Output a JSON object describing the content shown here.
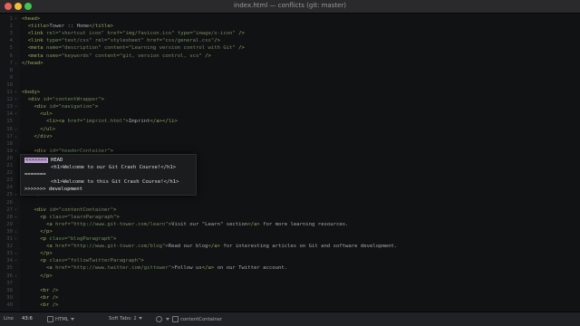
{
  "window": {
    "title": "index.html — conflicts (git: master)"
  },
  "colors": {
    "background": "#111214",
    "tag": "#9ea65c",
    "attr": "#6f8f4e",
    "string": "#6e8a57",
    "text": "#a8a8a2",
    "marker_highlight": "#bfa3d8"
  },
  "lines": [
    {
      "n": "1",
      "fold": "▾",
      "html": "<span class='t'>&lt;head&gt;</span>"
    },
    {
      "n": "2",
      "fold": "",
      "html": "  <span class='t'>&lt;title&gt;</span><span class='x'>Tower :: Home</span><span class='t'>&lt;/title&gt;</span>"
    },
    {
      "n": "3",
      "fold": "",
      "html": "  <span class='t'>&lt;link</span> <span class='a'>rel=</span><span class='s'>\"shortcut icon\"</span> <span class='a'>href=</span><span class='s'>\"img/favicon.ico\"</span> <span class='a'>type=</span><span class='s'>\"image/x-icon\"</span> <span class='t'>/&gt;</span>"
    },
    {
      "n": "4",
      "fold": "",
      "html": "  <span class='t'>&lt;link</span> <span class='a'>type=</span><span class='s'>\"text/css\"</span> <span class='a'>rel=</span><span class='s'>\"stylesheet\"</span> <span class='a'>href=</span><span class='s'>\"css/general.css\"</span><span class='t'>/&gt;</span>"
    },
    {
      "n": "5",
      "fold": "",
      "html": "  <span class='t'>&lt;meta</span> <span class='a'>name=</span><span class='s'>\"description\"</span> <span class='a'>content=</span><span class='s'>\"Learning version control with Git\"</span> <span class='t'>/&gt;</span>"
    },
    {
      "n": "6",
      "fold": "",
      "html": "  <span class='t'>&lt;meta</span> <span class='a'>name=</span><span class='s'>\"keywords\"</span> <span class='a'>content=</span><span class='s'>\"git, version control, vcs\"</span> <span class='t'>/&gt;</span>"
    },
    {
      "n": "7",
      "fold": "▴",
      "html": "<span class='t'>&lt;/head&gt;</span>"
    },
    {
      "n": "8",
      "fold": "",
      "html": ""
    },
    {
      "n": "9",
      "fold": "",
      "html": ""
    },
    {
      "n": "10",
      "fold": "",
      "html": ""
    },
    {
      "n": "11",
      "fold": "▾",
      "html": "<span class='t'>&lt;body&gt;</span>"
    },
    {
      "n": "12",
      "fold": "▾",
      "html": "  <span class='t'>&lt;div</span> <span class='a'>id=</span><span class='s'>\"contentWrapper\"</span><span class='t'>&gt;</span>"
    },
    {
      "n": "13",
      "fold": "▾",
      "html": "    <span class='t'>&lt;div</span> <span class='a'>id=</span><span class='s'>\"navigation\"</span><span class='t'>&gt;</span>"
    },
    {
      "n": "14",
      "fold": "▾",
      "html": "      <span class='t'>&lt;ul&gt;</span>"
    },
    {
      "n": "15",
      "fold": "",
      "html": "        <span class='t'>&lt;li&gt;&lt;a</span> <span class='a'>href=</span><span class='s'>\"imprint.html\"</span><span class='t'>&gt;</span><span class='x'>Imprint</span><span class='t'>&lt;/a&gt;&lt;/li&gt;</span>"
    },
    {
      "n": "16",
      "fold": "▴",
      "html": "      <span class='t'>&lt;/ul&gt;</span>"
    },
    {
      "n": "17",
      "fold": "▴",
      "html": "    <span class='t'>&lt;/div&gt;</span>"
    },
    {
      "n": "18",
      "fold": "",
      "html": ""
    },
    {
      "n": "19",
      "fold": "▾",
      "html": "    <span class='t'>&lt;div</span> <span class='a'>id=</span><span class='s'>\"headerContainer\"</span><span class='t'>&gt;</span>"
    },
    {
      "n": "20",
      "fold": "",
      "html": ""
    },
    {
      "n": "21",
      "fold": "",
      "html": ""
    },
    {
      "n": "22",
      "fold": "",
      "html": ""
    },
    {
      "n": "23",
      "fold": "",
      "html": ""
    },
    {
      "n": "24",
      "fold": "",
      "html": ""
    },
    {
      "n": "25",
      "fold": "▴",
      "html": "    <span class='t'>&lt;/div&gt;</span>"
    },
    {
      "n": "26",
      "fold": "",
      "html": ""
    },
    {
      "n": "27",
      "fold": "▾",
      "html": "    <span class='t'>&lt;div</span> <span class='a'>id=</span><span class='s'>\"contentContainer\"</span><span class='t'>&gt;</span>"
    },
    {
      "n": "28",
      "fold": "▾",
      "html": "      <span class='t'>&lt;p</span> <span class='a'>class=</span><span class='s'>\"learnParagraph\"</span><span class='t'>&gt;</span>"
    },
    {
      "n": "29",
      "fold": "",
      "html": "        <span class='t'>&lt;a</span> <span class='a'>href=</span><span class='s'>\"http://www.git-tower.com/learn\"</span><span class='t'>&gt;</span><span class='x'>Visit our \"Learn\" section</span><span class='t'>&lt;/a&gt;</span><span class='x'> for more learning resources.</span>"
    },
    {
      "n": "30",
      "fold": "▴",
      "html": "      <span class='t'>&lt;/p&gt;</span>"
    },
    {
      "n": "31",
      "fold": "▾",
      "html": "      <span class='t'>&lt;p</span> <span class='a'>class=</span><span class='s'>\"blogParagraph\"</span><span class='t'>&gt;</span>"
    },
    {
      "n": "32",
      "fold": "",
      "html": "        <span class='t'>&lt;a</span> <span class='a'>href=</span><span class='s'>\"http://www.git-tower.com/blog\"</span><span class='t'>&gt;</span><span class='x'>Read our blog</span><span class='t'>&lt;/a&gt;</span><span class='x'> for interesting articles on Git and software development.</span>"
    },
    {
      "n": "33",
      "fold": "▴",
      "html": "      <span class='t'>&lt;/p&gt;</span>"
    },
    {
      "n": "34",
      "fold": "▾",
      "html": "      <span class='t'>&lt;p</span> <span class='a'>class=</span><span class='s'>\"followTwitterParagraph\"</span><span class='t'>&gt;</span>"
    },
    {
      "n": "35",
      "fold": "",
      "html": "        <span class='t'>&lt;a</span> <span class='a'>href=</span><span class='s'>\"http://www.twitter.com/gittower\"</span><span class='t'>&gt;</span><span class='x'>Follow us</span><span class='t'>&lt;/a&gt;</span><span class='x'> on our Twitter account.</span>"
    },
    {
      "n": "36",
      "fold": "▴",
      "html": "      <span class='t'>&lt;/p&gt;</span>"
    },
    {
      "n": "37",
      "fold": "",
      "html": ""
    },
    {
      "n": "38",
      "fold": "",
      "html": "      <span class='t'>&lt;br /&gt;</span>"
    },
    {
      "n": "39",
      "fold": "",
      "html": "      <span class='t'>&lt;br /&gt;</span>"
    },
    {
      "n": "40",
      "fold": "",
      "html": "      <span class='t'>&lt;br /&gt;</span>"
    }
  ],
  "conflict": {
    "head_marker": "<<<<<<<",
    "head_label": " HEAD",
    "head_line": "<h1>Welcome to our Git Crash Course!</h1>",
    "separator": "=======",
    "dev_line": "<h1>Welcome to this Git Crash Course!</h1>",
    "dev_marker": ">>>>>>>",
    "dev_label": " development"
  },
  "status_bar": {
    "line_label": "Line",
    "position": "43:6",
    "language": "HTML",
    "tab_setting": "Soft Tabs: 2",
    "symbol": "contentContainer"
  }
}
